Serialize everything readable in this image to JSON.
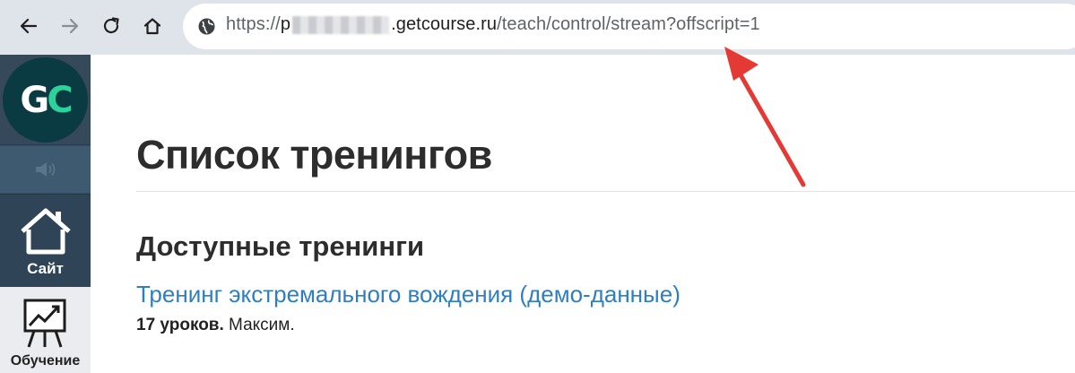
{
  "browser": {
    "url": {
      "scheme": "https://",
      "prefix": "p",
      "host": ".getcourse.ru",
      "path": "/teach/control/stream?offscript=1"
    },
    "icons": [
      "back-icon",
      "forward-icon",
      "reload-icon",
      "home-icon",
      "globe-icon"
    ]
  },
  "sidebar": {
    "logo": "GC",
    "items": [
      {
        "label": "",
        "icon": "speaker-icon"
      },
      {
        "label": "Сайт",
        "icon": "house-icon"
      },
      {
        "label": "Обучение",
        "icon": "chart-board-icon"
      }
    ]
  },
  "main": {
    "title": "Список тренингов",
    "section_title": "Доступные тренинги",
    "trainings": [
      {
        "title": "Тренинг экстремального вождения (демо-данные)",
        "lessons": "17 уроков.",
        "author": " Максим."
      }
    ]
  },
  "colors": {
    "sidebar": "#344e63",
    "link": "#2f7ec2",
    "logo_accent": "#2bd39b",
    "annotation": "#e53935"
  }
}
